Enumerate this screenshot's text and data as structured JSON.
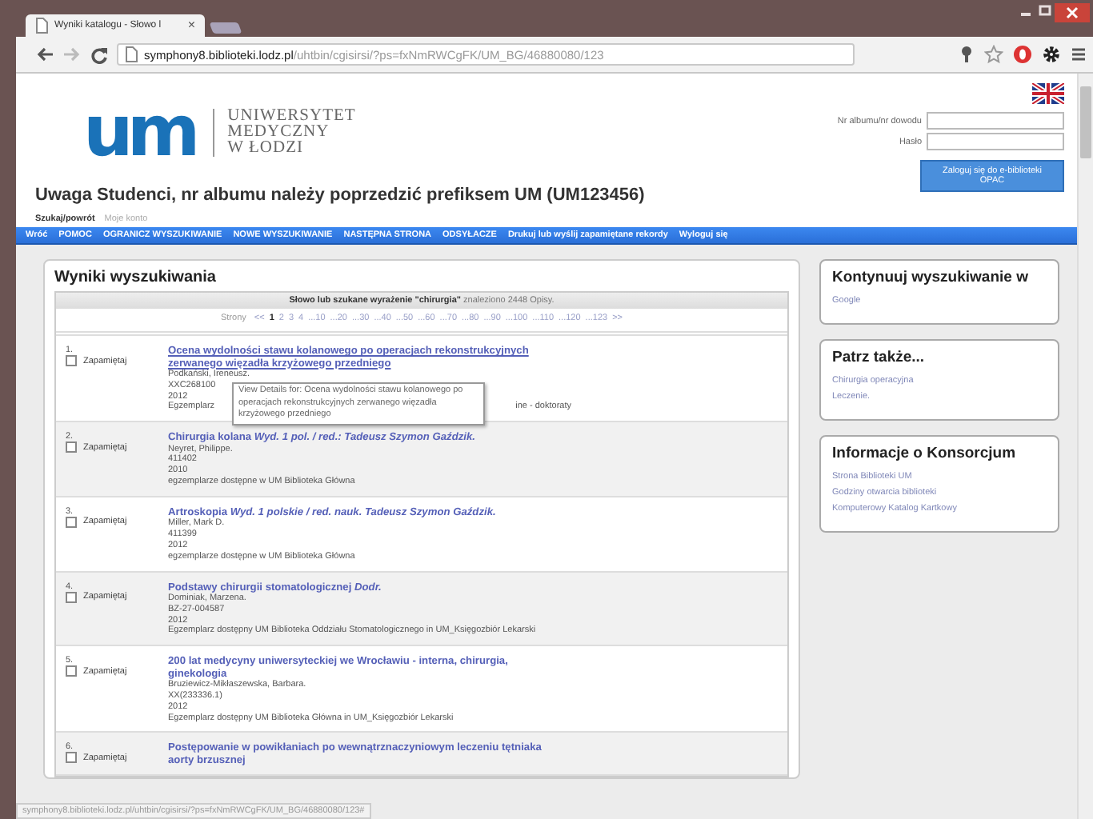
{
  "browser": {
    "tab_title": "Wyniki katalogu - Słowo l",
    "tab_close": "×",
    "url_host": "symphony8.biblioteki.lodz.pl",
    "url_path": "/uhtbin/cgisirsi/?ps=fxNmRWCgFK/UM_BG/46880080/123",
    "status_url": "symphony8.biblioteki.lodz.pl/uhtbin/cgisirsi/?ps=fxNmRWCgFK/UM_BG/46880080/123#"
  },
  "header": {
    "logo_mark": "um",
    "logo_lines": [
      "UNIWERSYTET",
      "MEDYCZNY",
      "W ŁODZI"
    ],
    "login_fields": [
      {
        "label": "Nr albumu/nr dowodu"
      },
      {
        "label": "Hasło"
      }
    ],
    "login_button": "Zaloguj się do e-biblioteki OPAC",
    "notice": "Uwaga Studenci, nr albumu należy poprzedzić prefiksem UM (UM123456)",
    "subtabs": [
      {
        "label": "Szukaj/powrót",
        "selected": true
      },
      {
        "label": "Moje konto",
        "selected": false
      }
    ]
  },
  "nav": [
    "Wróć",
    "POMOC",
    "OGRANICZ WYSZUKIWANIE",
    "NOWE WYSZUKIWANIE",
    "NASTĘPNA STRONA",
    "ODSYŁACZE",
    "Drukuj lub wyślij zapamiętane rekordy",
    "Wyloguj się"
  ],
  "results": {
    "title": "Wyniki wyszukiwania",
    "summary": "**Słowo lub szukane wyrażenie \"chirurgia\"** znaleziono 2448 Opisy.",
    "pages_label": "Strony",
    "pages": [
      {
        "label": "<<",
        "selected": false
      },
      {
        "label": "1",
        "selected": true
      },
      {
        "label": "2",
        "selected": false
      },
      {
        "label": "3",
        "selected": false
      },
      {
        "label": "4",
        "selected": false
      },
      {
        "label": "...10",
        "selected": false
      },
      {
        "label": "...20",
        "selected": false
      },
      {
        "label": "...30",
        "selected": false
      },
      {
        "label": "...40",
        "selected": false
      },
      {
        "label": "...50",
        "selected": false
      },
      {
        "label": "...60",
        "selected": false
      },
      {
        "label": "...70",
        "selected": false
      },
      {
        "label": "...80",
        "selected": false
      },
      {
        "label": "...90",
        "selected": false
      },
      {
        "label": "...100",
        "selected": false
      },
      {
        "label": "...110",
        "selected": false
      },
      {
        "label": "...120",
        "selected": false
      },
      {
        "label": "...123",
        "selected": false
      },
      {
        "label": ">>",
        "selected": false
      }
    ],
    "items": [
      {
        "number": "1.",
        "save_label": "Zapamiętaj",
        "checked": false,
        "hovered": true,
        "title": "Ocena wydolności stawu kolanowego po operacjach rekonstrukcyjnych zerwanego więzadła krzyżowego przedniego",
        "lines": [
          [
            "Podkański, Ireneusz."
          ],
          [
            "XXC268100"
          ],
          [
            "2012"
          ],
          [
            "Egzemplarz",
            "ine - doktoraty"
          ]
        ],
        "tooltip": "View Details for: Ocena wydolności stawu kolanowego po operacjach rekonstrukcyjnych zerwanego więzadła krzyżowego przedniego"
      },
      {
        "number": "2.",
        "save_label": "Zapamiętaj",
        "checked": false,
        "hovered": false,
        "title": "Chirurgia kolana *Wyd. 1 pol. / red.: Tadeusz Szymon Gaździk.*",
        "lines": [
          [
            "Neyret, Philippe."
          ],
          [
            "411402"
          ],
          [
            "2010"
          ],
          [
            "egzemplarze dostępne w UM Biblioteka Główna"
          ]
        ]
      },
      {
        "number": "3.",
        "save_label": "Zapamiętaj",
        "checked": false,
        "hovered": false,
        "title": "Artroskopia *Wyd. 1 polskie / red. nauk. Tadeusz Szymon Gaździk.*",
        "lines": [
          [
            "Miller, Mark D."
          ],
          [
            "411399"
          ],
          [
            "2012"
          ],
          [
            "egzemplarze dostępne w UM Biblioteka Główna"
          ]
        ]
      },
      {
        "number": "4.",
        "save_label": "Zapamiętaj",
        "checked": false,
        "hovered": false,
        "title": "Podstawy chirurgii stomatologicznej *Dodr.*",
        "lines": [
          [
            "Dominiak, Marzena."
          ],
          [
            "BZ-27-004587"
          ],
          [
            "2012"
          ],
          [
            "Egzemplarz dostępny UM Biblioteka Oddziału Stomatologicznego in UM_Księgozbiór Lekarski"
          ]
        ]
      },
      {
        "number": "5.",
        "save_label": "Zapamiętaj",
        "checked": false,
        "hovered": false,
        "title": "200 lat medycyny uniwersyteckiej we Wrocławiu - interna, chirurgia, ginekologia",
        "lines": [
          [
            "Bruziewicz-Mikłaszewska, Barbara."
          ],
          [
            "XX(233336.1)"
          ],
          [
            "2012"
          ],
          [
            "Egzemplarz dostępny UM Biblioteka Główna in UM_Księgozbiór Lekarski"
          ]
        ]
      },
      {
        "number": "6.",
        "save_label": "Zapamiętaj",
        "checked": false,
        "hovered": false,
        "title": "Postępowanie w powikłaniach po wewnątrznaczyniowym leczeniu tętniaka aorty brzusznej"
      }
    ]
  },
  "sidebar": [
    {
      "title": "Kontynuuj wyszukiwanie w",
      "links": [
        "Google"
      ]
    },
    {
      "title": "Patrz także...",
      "links": [
        "Chirurgia operacyjna",
        "Leczenie."
      ]
    },
    {
      "title": "Informacje o Konsorcjum",
      "links": [
        "Strona Biblioteki UM",
        "Godziny otwarcia biblioteki",
        "Komputerowy Katalog Kartkowy"
      ]
    }
  ]
}
